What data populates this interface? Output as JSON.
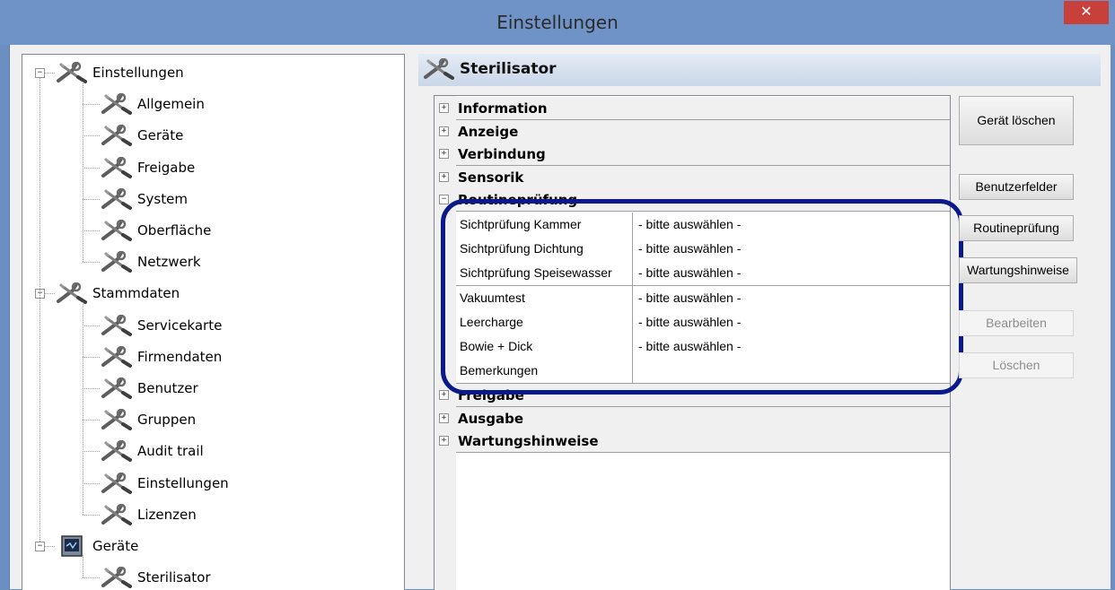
{
  "window": {
    "title": "Einstellungen",
    "close_label": "✕"
  },
  "tree": {
    "nodes": [
      {
        "label": "Einstellungen",
        "level": 0,
        "icon": "tools-icon",
        "expanded": true
      },
      {
        "label": "Allgemein",
        "level": 1,
        "icon": "tools-icon"
      },
      {
        "label": "Geräte",
        "level": 1,
        "icon": "tools-icon"
      },
      {
        "label": "Freigabe",
        "level": 1,
        "icon": "tools-icon"
      },
      {
        "label": "System",
        "level": 1,
        "icon": "tools-icon"
      },
      {
        "label": "Oberfläche",
        "level": 1,
        "icon": "tools-icon"
      },
      {
        "label": "Netzwerk",
        "level": 1,
        "icon": "tools-icon"
      },
      {
        "label": "Stammdaten",
        "level": 0,
        "icon": "tools-icon",
        "expanded": true
      },
      {
        "label": "Servicekarte",
        "level": 1,
        "icon": "tools-icon"
      },
      {
        "label": "Firmendaten",
        "level": 1,
        "icon": "tools-icon"
      },
      {
        "label": "Benutzer",
        "level": 1,
        "icon": "tools-icon"
      },
      {
        "label": "Gruppen",
        "level": 1,
        "icon": "tools-icon"
      },
      {
        "label": "Audit trail",
        "level": 1,
        "icon": "tools-icon"
      },
      {
        "label": "Einstellungen",
        "level": 1,
        "icon": "tools-icon"
      },
      {
        "label": "Lizenzen",
        "level": 1,
        "icon": "tools-icon"
      },
      {
        "label": "Geräte",
        "level": 0,
        "icon": "device-monitor-icon",
        "expanded": true
      },
      {
        "label": "Sterilisator",
        "level": 1,
        "icon": "tools-icon"
      }
    ]
  },
  "panel": {
    "title": "Sterilisator",
    "icon": "tools-icon"
  },
  "property_grid": {
    "categories_top": [
      {
        "label": "Information",
        "expander": "+"
      },
      {
        "label": "Anzeige",
        "expander": "+"
      },
      {
        "label": "Verbindung",
        "expander": "+"
      },
      {
        "label": "Sensorik",
        "expander": "+"
      },
      {
        "label": "Routineprüfung",
        "expander": "−"
      }
    ],
    "rows": [
      {
        "name": "Sichtprüfung Kammer",
        "value": "- bitte auswählen -"
      },
      {
        "name": "Sichtprüfung Dichtung",
        "value": "- bitte auswählen -"
      },
      {
        "name": "Sichtprüfung Speisewasser",
        "value": "- bitte auswählen -"
      },
      {
        "name": "Vakuumtest",
        "value": "- bitte auswählen -"
      },
      {
        "name": "Leercharge",
        "value": "- bitte auswählen -"
      },
      {
        "name": "Bowie + Dick",
        "value": "- bitte auswählen -"
      },
      {
        "name": "Bemerkungen",
        "value": ""
      }
    ],
    "categories_bottom": [
      {
        "label": "Freigabe",
        "expander": "+"
      },
      {
        "label": "Ausgabe",
        "expander": "+"
      },
      {
        "label": "Wartungshinweise",
        "expander": "+"
      }
    ]
  },
  "buttons": {
    "delete_device": "Gerät löschen",
    "user_fields": "Benutzerfelder",
    "routine_check": "Routineprüfung",
    "maintenance_notes": "Wartungshinweise",
    "edit": "Bearbeiten",
    "delete": "Löschen"
  },
  "colors": {
    "titlebar": "#6f93c6",
    "highlight_ring": "#0b1a8a",
    "close": "#c7403a"
  }
}
